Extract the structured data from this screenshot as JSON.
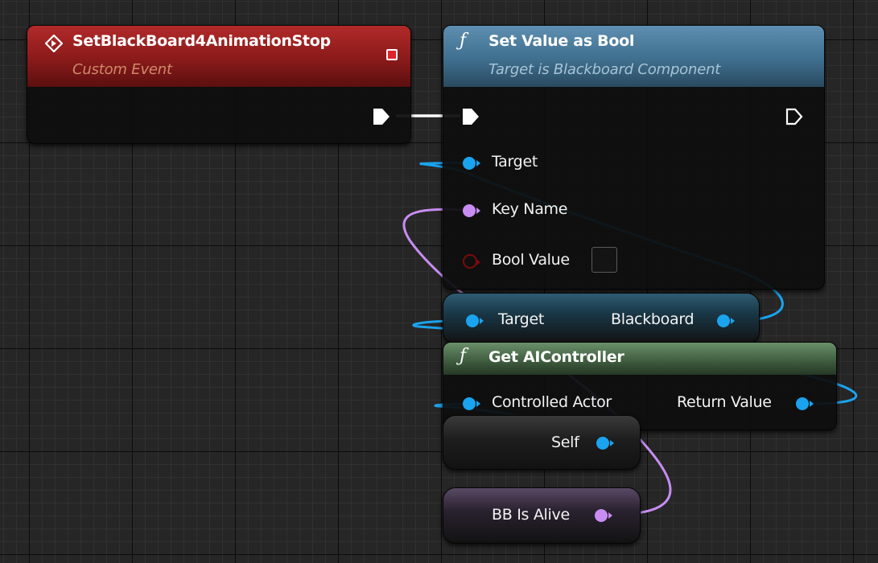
{
  "nodes": {
    "custom_event": {
      "title": "SetBlackBoard4AnimationStop",
      "subtitle": "Custom Event",
      "icon": "event-diamond-icon",
      "header_color": "#8a1a1a",
      "delegate_pin_color": "#e0242a"
    },
    "set_value_as_bool": {
      "title": "Set Value as Bool",
      "subtitle": "Target is Blackboard Component",
      "icon": "function-icon",
      "icon_glyph": "ƒ",
      "header_color": "#3f6f8f",
      "pins": {
        "target": "Target",
        "key_name": "Key Name",
        "bool_value": "Bool Value"
      }
    },
    "get_blackboard": {
      "input_label": "Target",
      "output_label": "Blackboard"
    },
    "get_ai_controller": {
      "title": "Get AIController",
      "icon_glyph": "ƒ",
      "header_color": "#3d5a3d",
      "input_label": "Controlled Actor",
      "output_label": "Return Value"
    },
    "self": {
      "output_label": "Self"
    },
    "bb_is_alive": {
      "output_label": "BB Is Alive"
    }
  },
  "colors": {
    "object_pin": "#1aa3ee",
    "name_pin": "#c78df2",
    "bool_pin": "#7a0b0b",
    "exec_wire": "#ffffff",
    "graph_background": "#262626"
  }
}
